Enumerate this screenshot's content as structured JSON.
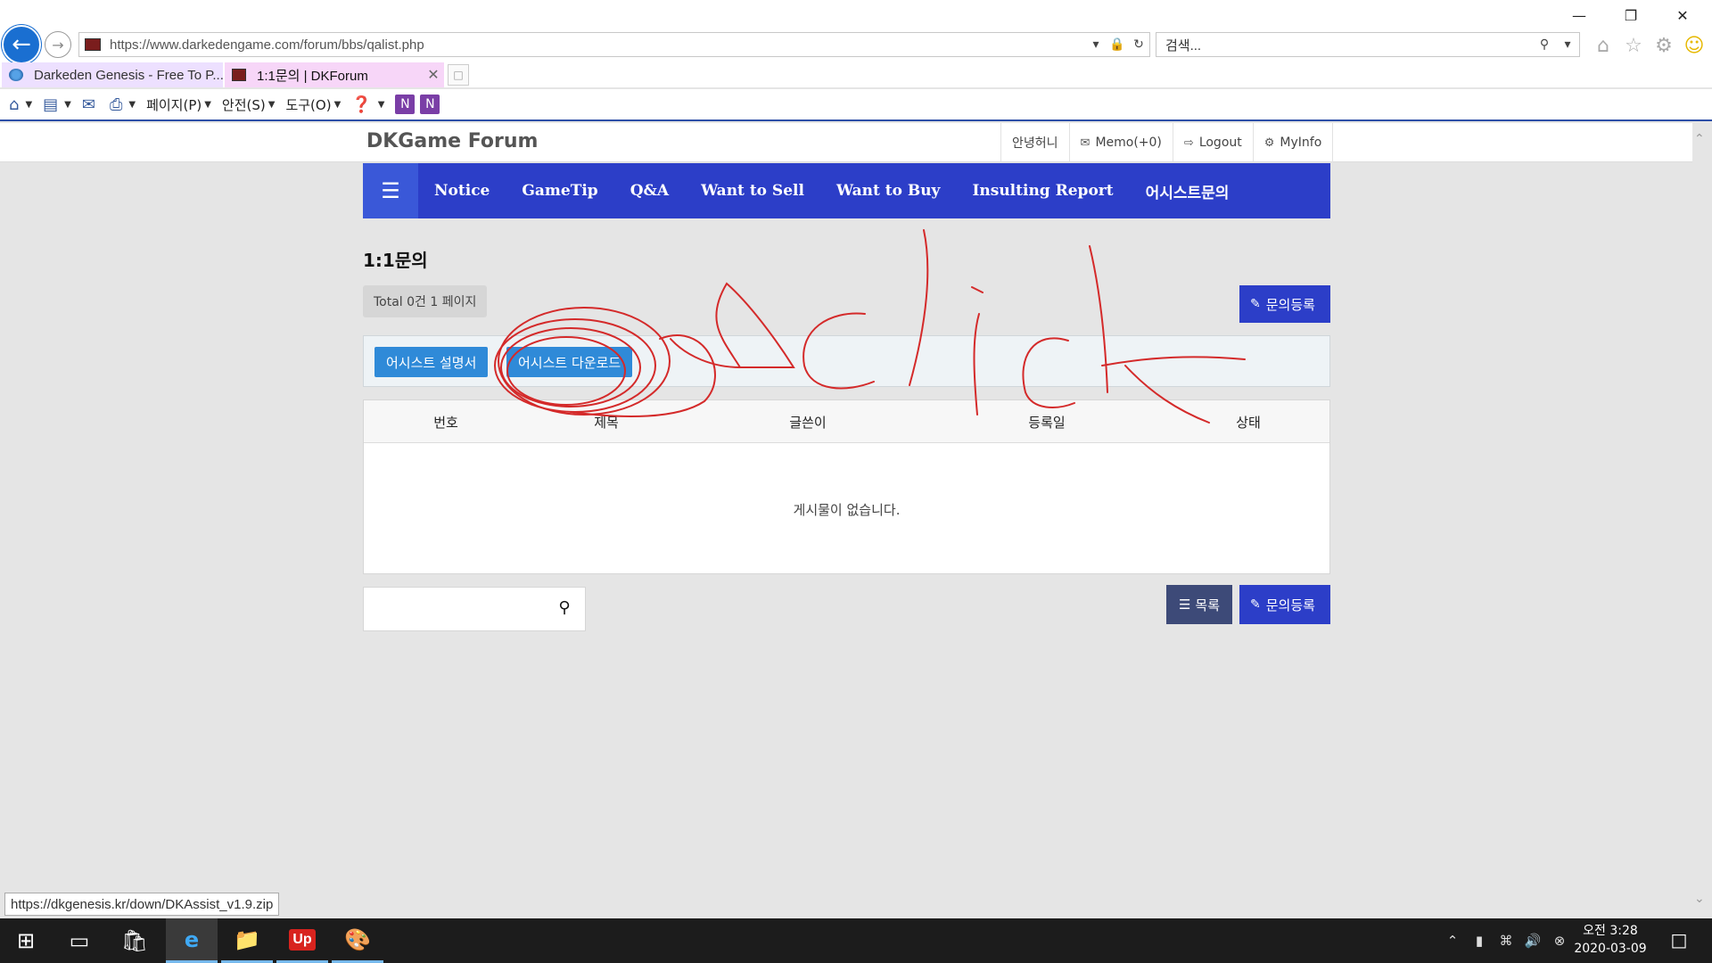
{
  "browser": {
    "url": "https://www.darkedengame.com/forum/bbs/qalist.php",
    "search_placeholder": "검색...",
    "tabs": [
      {
        "title": "Darkeden Genesis - Free To P..."
      },
      {
        "title": "1:1문의 | DKForum"
      }
    ],
    "command_bar": {
      "page_menu": "페이지(P)",
      "safety_menu": "안전(S)",
      "tools_menu": "도구(O)"
    },
    "status_url": "https://dkgenesis.kr/down/DKAssist_v1.9.zip"
  },
  "site": {
    "logo": "DKGame Forum",
    "user_menu": {
      "greeting": "안녕허니",
      "memo": "Memo(+0)",
      "logout": "Logout",
      "myinfo": "MyInfo"
    },
    "nav": [
      "Notice",
      "GameTip",
      "Q&A",
      "Want to Sell",
      "Want to Buy",
      "Insulting Report",
      "어시스트문의"
    ]
  },
  "board": {
    "title": "1:1문의",
    "total": "Total 0건 1 페이지",
    "write_label": "문의등록",
    "list_label": "목록",
    "assist_manual": "어시스트 설명서",
    "assist_download": "어시스트 다운로드",
    "columns": {
      "no": "번호",
      "subject": "제목",
      "writer": "글쓴이",
      "date": "등록일",
      "status": "상태"
    },
    "empty_message": "게시물이 없습니다."
  },
  "annotation": {
    "text": "click",
    "color": "#d42a2a"
  },
  "taskbar": {
    "clock_time": "오전 3:28",
    "clock_date": "2020-03-09"
  }
}
